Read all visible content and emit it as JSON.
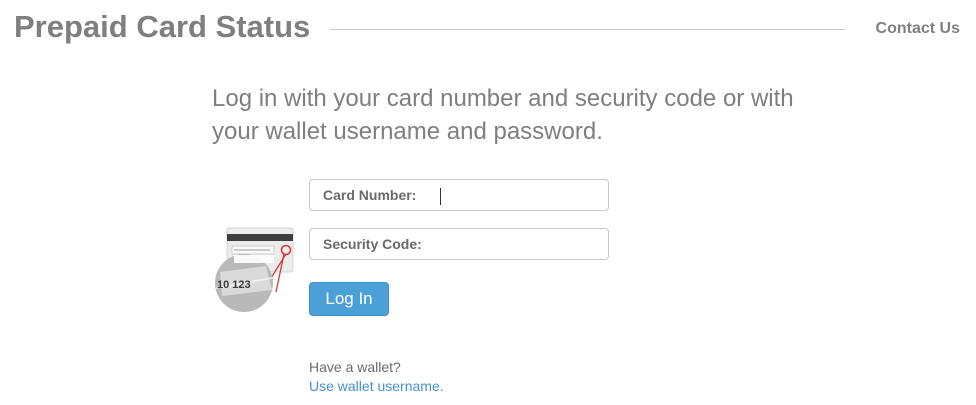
{
  "header": {
    "title": "Prepaid Card Status",
    "contact_label": "Contact Us"
  },
  "intro": {
    "text": "Log in with your card number and security code or with your wallet username and password."
  },
  "illustration": {
    "icon": "card-security-code-icon",
    "sample_digits": "10  123"
  },
  "form": {
    "card_number": {
      "label": "Card Number:",
      "value": "",
      "placeholder": ""
    },
    "security_code": {
      "label": "Security Code:",
      "value": "",
      "placeholder": ""
    },
    "login_label": "Log In"
  },
  "wallet": {
    "question": "Have a wallet?",
    "link_label": "Use wallet username."
  },
  "colors": {
    "heading_gray": "#7f7f7f",
    "button_blue": "#4ba0d8",
    "link_blue": "#4a90c8",
    "accent_red": "#d23a3a"
  }
}
